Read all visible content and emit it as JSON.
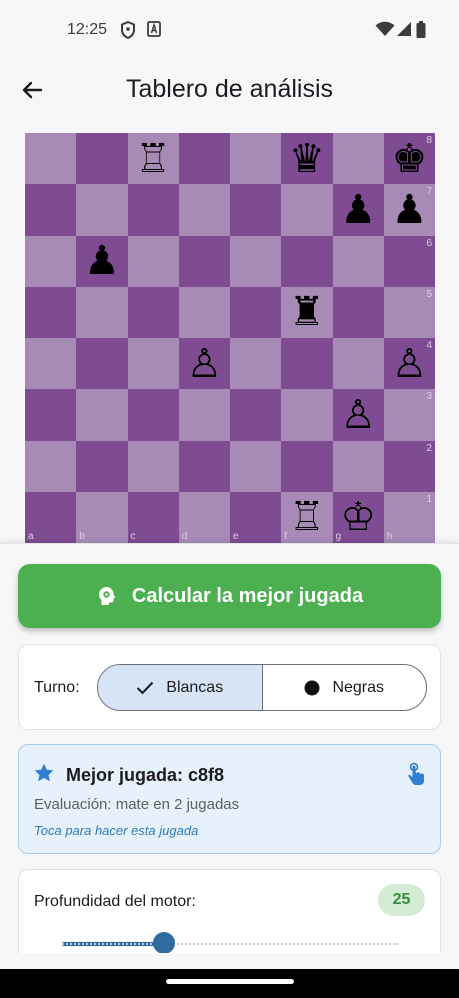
{
  "status_bar": {
    "time": "12:25"
  },
  "app_bar": {
    "title": "Tablero de análisis"
  },
  "board": {
    "ranks": [
      "8",
      "7",
      "6",
      "5",
      "4",
      "3",
      "2",
      "1"
    ],
    "files": [
      "a",
      "b",
      "c",
      "d",
      "e",
      "f",
      "g",
      "h"
    ],
    "pieces": [
      {
        "square": "c8",
        "glyph": "♖",
        "name": "white-rook"
      },
      {
        "square": "f8",
        "glyph": "♛",
        "name": "black-queen"
      },
      {
        "square": "h8",
        "glyph": "♚",
        "name": "black-king"
      },
      {
        "square": "g7",
        "glyph": "♟",
        "name": "black-pawn"
      },
      {
        "square": "h7",
        "glyph": "♟",
        "name": "black-pawn"
      },
      {
        "square": "b6",
        "glyph": "♟",
        "name": "black-pawn"
      },
      {
        "square": "f5",
        "glyph": "♜",
        "name": "black-rook"
      },
      {
        "square": "d4",
        "glyph": "♙",
        "name": "white-pawn"
      },
      {
        "square": "h4",
        "glyph": "♙",
        "name": "white-pawn"
      },
      {
        "square": "g3",
        "glyph": "♙",
        "name": "white-pawn"
      },
      {
        "square": "f1",
        "glyph": "♖",
        "name": "white-rook"
      },
      {
        "square": "g1",
        "glyph": "♔",
        "name": "white-king"
      }
    ],
    "colors": {
      "light": "#a78bb6",
      "dark": "#7f4c93"
    }
  },
  "actions": {
    "calculate_label": "Calcular la mejor jugada"
  },
  "turn": {
    "label": "Turno:",
    "options": [
      "Blancas",
      "Negras"
    ],
    "selected": "Blancas"
  },
  "best_move": {
    "title": "Mejor jugada: c8f8",
    "evaluation": "Evaluación: mate en 2 jugadas",
    "hint": "Toca para hacer esta jugada"
  },
  "engine": {
    "depth_label": "Profundidad del motor:",
    "depth_value": "25",
    "slider_fraction": 0.29
  },
  "colors": {
    "accent_green": "#4caf50",
    "accent_blue": "#2f6aa0"
  }
}
